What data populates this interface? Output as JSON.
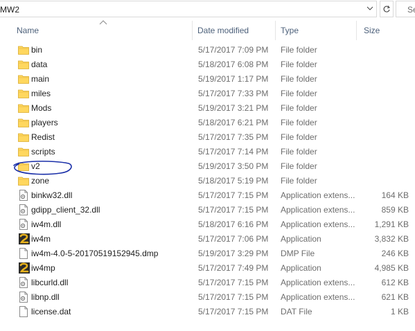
{
  "address": {
    "path": "MW2",
    "search_placeholder": "Se"
  },
  "columns": {
    "name": "Name",
    "date": "Date modified",
    "type": "Type",
    "size": "Size"
  },
  "files": [
    {
      "name": "bin",
      "date": "5/17/2017 7:09 PM",
      "type": "File folder",
      "size": "",
      "icon": "folder-icon"
    },
    {
      "name": "data",
      "date": "5/18/2017 6:08 PM",
      "type": "File folder",
      "size": "",
      "icon": "folder-icon"
    },
    {
      "name": "main",
      "date": "5/19/2017 1:17 PM",
      "type": "File folder",
      "size": "",
      "icon": "folder-icon"
    },
    {
      "name": "miles",
      "date": "5/17/2017 7:33 PM",
      "type": "File folder",
      "size": "",
      "icon": "folder-icon"
    },
    {
      "name": "Mods",
      "date": "5/19/2017 3:21 PM",
      "type": "File folder",
      "size": "",
      "icon": "folder-icon"
    },
    {
      "name": "players",
      "date": "5/18/2017 6:21 PM",
      "type": "File folder",
      "size": "",
      "icon": "folder-icon"
    },
    {
      "name": "Redist",
      "date": "5/17/2017 7:35 PM",
      "type": "File folder",
      "size": "",
      "icon": "folder-icon"
    },
    {
      "name": "scripts",
      "date": "5/17/2017 7:14 PM",
      "type": "File folder",
      "size": "",
      "icon": "folder-icon"
    },
    {
      "name": "v2",
      "date": "5/19/2017 3:50 PM",
      "type": "File folder",
      "size": "",
      "icon": "folder-icon"
    },
    {
      "name": "zone",
      "date": "5/18/2017 5:19 PM",
      "type": "File folder",
      "size": "",
      "icon": "folder-icon"
    },
    {
      "name": "binkw32.dll",
      "date": "5/17/2017 7:15 PM",
      "type": "Application extens...",
      "size": "164 KB",
      "icon": "dll-icon"
    },
    {
      "name": "gdipp_client_32.dll",
      "date": "5/17/2017 7:15 PM",
      "type": "Application extens...",
      "size": "859 KB",
      "icon": "dll-icon"
    },
    {
      "name": "iw4m.dll",
      "date": "5/18/2017 6:16 PM",
      "type": "Application extens...",
      "size": "1,291 KB",
      "icon": "dll-icon"
    },
    {
      "name": "iw4m",
      "date": "5/17/2017 7:06 PM",
      "type": "Application",
      "size": "3,832 KB",
      "icon": "app-icon"
    },
    {
      "name": "iw4m-4.0-5-20170519152945.dmp",
      "date": "5/19/2017 3:29 PM",
      "type": "DMP File",
      "size": "246 KB",
      "icon": "file-icon"
    },
    {
      "name": "iw4mp",
      "date": "5/17/2017 7:49 PM",
      "type": "Application",
      "size": "4,985 KB",
      "icon": "app-icon"
    },
    {
      "name": "libcurld.dll",
      "date": "5/17/2017 7:15 PM",
      "type": "Application extens...",
      "size": "612 KB",
      "icon": "dll-icon"
    },
    {
      "name": "libnp.dll",
      "date": "5/17/2017 7:15 PM",
      "type": "Application extens...",
      "size": "621 KB",
      "icon": "dll-icon"
    },
    {
      "name": "license.dat",
      "date": "5/17/2017 7:15 PM",
      "type": "DAT File",
      "size": "1 KB",
      "icon": "file-icon"
    }
  ],
  "colors": {
    "folder": "#ffd75e",
    "header_text": "#4c607a",
    "secondary_text": "#6d6d6d",
    "annotation": "#1a2fa8",
    "app_icon_bg": "#2b2b2b",
    "app_icon_fg": "#e8b21c"
  }
}
